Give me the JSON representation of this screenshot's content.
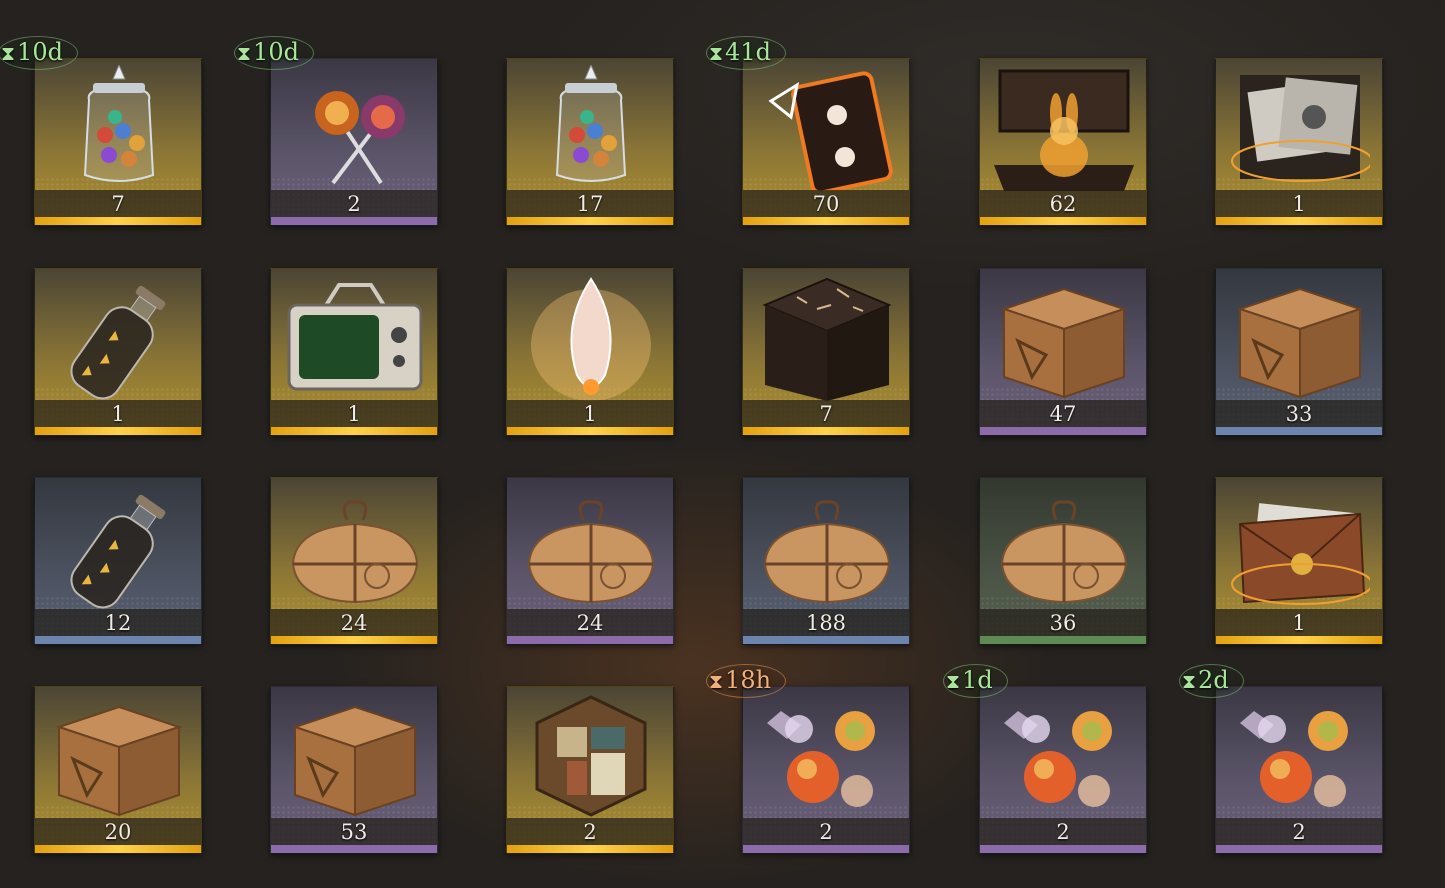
{
  "inventory": {
    "timer_icon": "hourglass-icon",
    "rows": [
      [
        {
          "name": "candy-jar",
          "icon": "candy-jar-icon",
          "qty": "7",
          "rarity": "gold",
          "timer": "10d"
        },
        {
          "name": "lollipops",
          "icon": "lollipops-icon",
          "qty": "2",
          "rarity": "purple",
          "timer": "10d"
        },
        {
          "name": "candy-jar",
          "icon": "candy-jar-icon",
          "qty": "17",
          "rarity": "gold",
          "timer": ""
        },
        {
          "name": "cassette-device",
          "icon": "cassette-device-icon",
          "qty": "70",
          "rarity": "gold",
          "timer": "41d"
        },
        {
          "name": "rabbit-box",
          "icon": "rabbit-box-icon",
          "qty": "62",
          "rarity": "gold",
          "timer": ""
        },
        {
          "name": "photo-chest",
          "icon": "photo-chest-icon",
          "qty": "1",
          "rarity": "gold",
          "timer": ""
        }
      ],
      [
        {
          "name": "message-bottle",
          "icon": "message-bottle-icon",
          "qty": "1",
          "rarity": "gold",
          "timer": ""
        },
        {
          "name": "old-television",
          "icon": "old-television-icon",
          "qty": "1",
          "rarity": "gold",
          "timer": ""
        },
        {
          "name": "glowing-crystal",
          "icon": "glowing-crystal-icon",
          "qty": "1",
          "rarity": "gold",
          "timer": ""
        },
        {
          "name": "rune-cube",
          "icon": "rune-cube-icon",
          "qty": "7",
          "rarity": "gold",
          "timer": ""
        },
        {
          "name": "supply-crate",
          "icon": "wooden-crate-icon",
          "qty": "47",
          "rarity": "purple",
          "timer": ""
        },
        {
          "name": "supply-crate",
          "icon": "wooden-crate-icon",
          "qty": "33",
          "rarity": "blue",
          "timer": ""
        }
      ],
      [
        {
          "name": "message-bottle",
          "icon": "message-bottle-icon",
          "qty": "12",
          "rarity": "blue",
          "timer": ""
        },
        {
          "name": "paper-parcel",
          "icon": "paper-parcel-icon",
          "qty": "24",
          "rarity": "gold",
          "timer": ""
        },
        {
          "name": "paper-parcel",
          "icon": "paper-parcel-icon",
          "qty": "24",
          "rarity": "purple",
          "timer": ""
        },
        {
          "name": "paper-parcel",
          "icon": "paper-parcel-icon",
          "qty": "188",
          "rarity": "blue",
          "timer": ""
        },
        {
          "name": "paper-parcel",
          "icon": "paper-parcel-icon",
          "qty": "36",
          "rarity": "green",
          "timer": ""
        },
        {
          "name": "sealed-envelope",
          "icon": "sealed-envelope-icon",
          "qty": "1",
          "rarity": "gold",
          "timer": ""
        }
      ],
      [
        {
          "name": "supply-crate",
          "icon": "wooden-crate-icon",
          "qty": "20",
          "rarity": "gold",
          "timer": ""
        },
        {
          "name": "supply-crate",
          "icon": "wooden-crate-icon",
          "qty": "53",
          "rarity": "purple",
          "timer": ""
        },
        {
          "name": "puzzle-tile",
          "icon": "puzzle-tile-icon",
          "qty": "2",
          "rarity": "gold",
          "timer": ""
        },
        {
          "name": "wrapped-candies",
          "icon": "wrapped-candies-icon",
          "qty": "2",
          "rarity": "purple",
          "timer": "18h",
          "timer_color": "orange"
        },
        {
          "name": "wrapped-candies",
          "icon": "wrapped-candies-icon",
          "qty": "2",
          "rarity": "purple",
          "timer": "1d"
        },
        {
          "name": "wrapped-candies",
          "icon": "wrapped-candies-icon",
          "qty": "2",
          "rarity": "purple",
          "timer": "2d"
        }
      ]
    ]
  }
}
